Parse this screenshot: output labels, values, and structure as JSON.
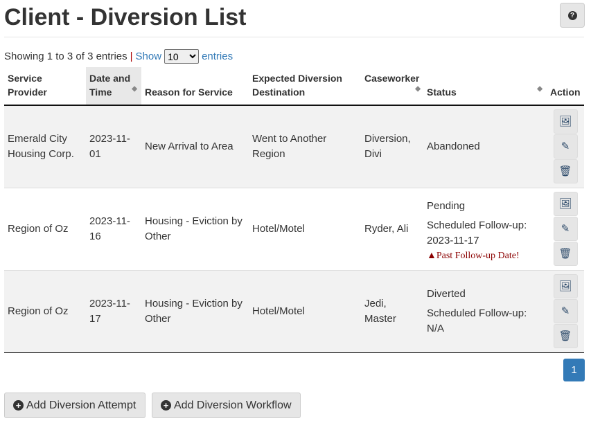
{
  "page": {
    "title": "Client - Diversion List",
    "help_icon": "question-circle-icon"
  },
  "info": {
    "showing": "Showing 1 to 3 of 3 entries",
    "separator": "|",
    "show": "Show",
    "length": "10",
    "entries": "entries"
  },
  "table": {
    "headers": [
      "Service Provider",
      "Date and Time",
      "Reason for Service",
      "Expected Diversion Destination",
      "Caseworker",
      "Status",
      "Action"
    ],
    "rows": [
      {
        "provider": "Emerald City Housing Corp.",
        "date": "2023-11-01",
        "reason": "New Arrival to Area",
        "destination": "Went to Another Region",
        "caseworker": "Diversion, Divi",
        "status": "Abandoned",
        "followup_label": "",
        "followup": "",
        "warning": ""
      },
      {
        "provider": "Region of Oz",
        "date": "2023-11-16",
        "reason": "Housing - Eviction by Other",
        "destination": "Hotel/Motel",
        "caseworker": "Ryder, Ali",
        "status": "Pending",
        "followup_label": "Scheduled Follow-up:",
        "followup": "2023-11-17",
        "warning": "Past Follow-up Date!"
      },
      {
        "provider": "Region of Oz",
        "date": "2023-11-17",
        "reason": "Housing - Eviction by Other",
        "destination": "Hotel/Motel",
        "caseworker": "Jedi, Master",
        "status": "Diverted",
        "followup_label": "Scheduled Follow-up:",
        "followup": "N/A",
        "warning": ""
      }
    ]
  },
  "pagination": {
    "current": "1",
    "color": "#337ab7"
  },
  "buttons": {
    "add_attempt": "Add Diversion Attempt",
    "add_workflow": "Add Diversion Workflow"
  }
}
